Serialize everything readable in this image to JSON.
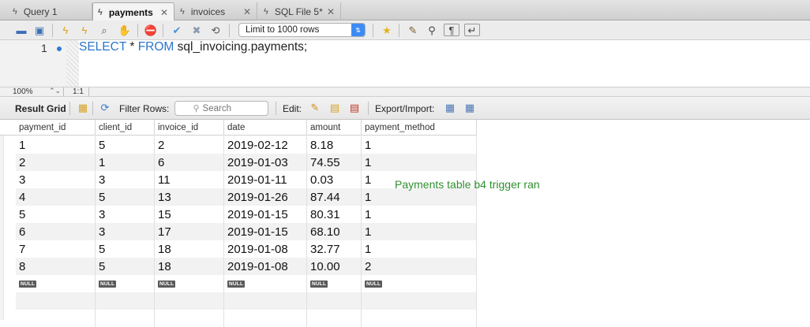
{
  "tabs": [
    {
      "label": "Query 1",
      "icon": "lightning-icon",
      "active": false
    },
    {
      "label": "payments",
      "icon": "lightning-icon",
      "active": true
    },
    {
      "label": "invoices",
      "icon": "lightning-icon",
      "active": false
    },
    {
      "label": "SQL File 5*",
      "icon": "lightning-icon",
      "active": false
    }
  ],
  "toolbar": {
    "limit_label": "Limit to 1000 rows"
  },
  "editor": {
    "line_number": "1",
    "code_kw1": "SELECT",
    "code_mid": " * ",
    "code_kw2": "FROM",
    "code_rest": " sql_invoicing.payments;"
  },
  "zoom": {
    "value": "100%",
    "ratio": "1:1"
  },
  "result_toolbar": {
    "result_grid": "Result Grid",
    "filter_rows": "Filter Rows:",
    "search_placeholder": "Search",
    "edit": "Edit:",
    "export_import": "Export/Import:"
  },
  "grid": {
    "columns": [
      "payment_id",
      "client_id",
      "invoice_id",
      "date",
      "amount",
      "payment_method"
    ],
    "rows": [
      [
        "1",
        "5",
        "2",
        "2019-02-12",
        "8.18",
        "1"
      ],
      [
        "2",
        "1",
        "6",
        "2019-01-03",
        "74.55",
        "1"
      ],
      [
        "3",
        "3",
        "11",
        "2019-01-11",
        "0.03",
        "1"
      ],
      [
        "4",
        "5",
        "13",
        "2019-01-26",
        "87.44",
        "1"
      ],
      [
        "5",
        "3",
        "15",
        "2019-01-15",
        "80.31",
        "1"
      ],
      [
        "6",
        "3",
        "17",
        "2019-01-15",
        "68.10",
        "1"
      ],
      [
        "7",
        "5",
        "18",
        "2019-01-08",
        "32.77",
        "1"
      ],
      [
        "8",
        "5",
        "18",
        "2019-01-08",
        "10.00",
        "2"
      ]
    ],
    "null_label": "NULL",
    "annotation": "Payments table b4 trigger ran"
  }
}
